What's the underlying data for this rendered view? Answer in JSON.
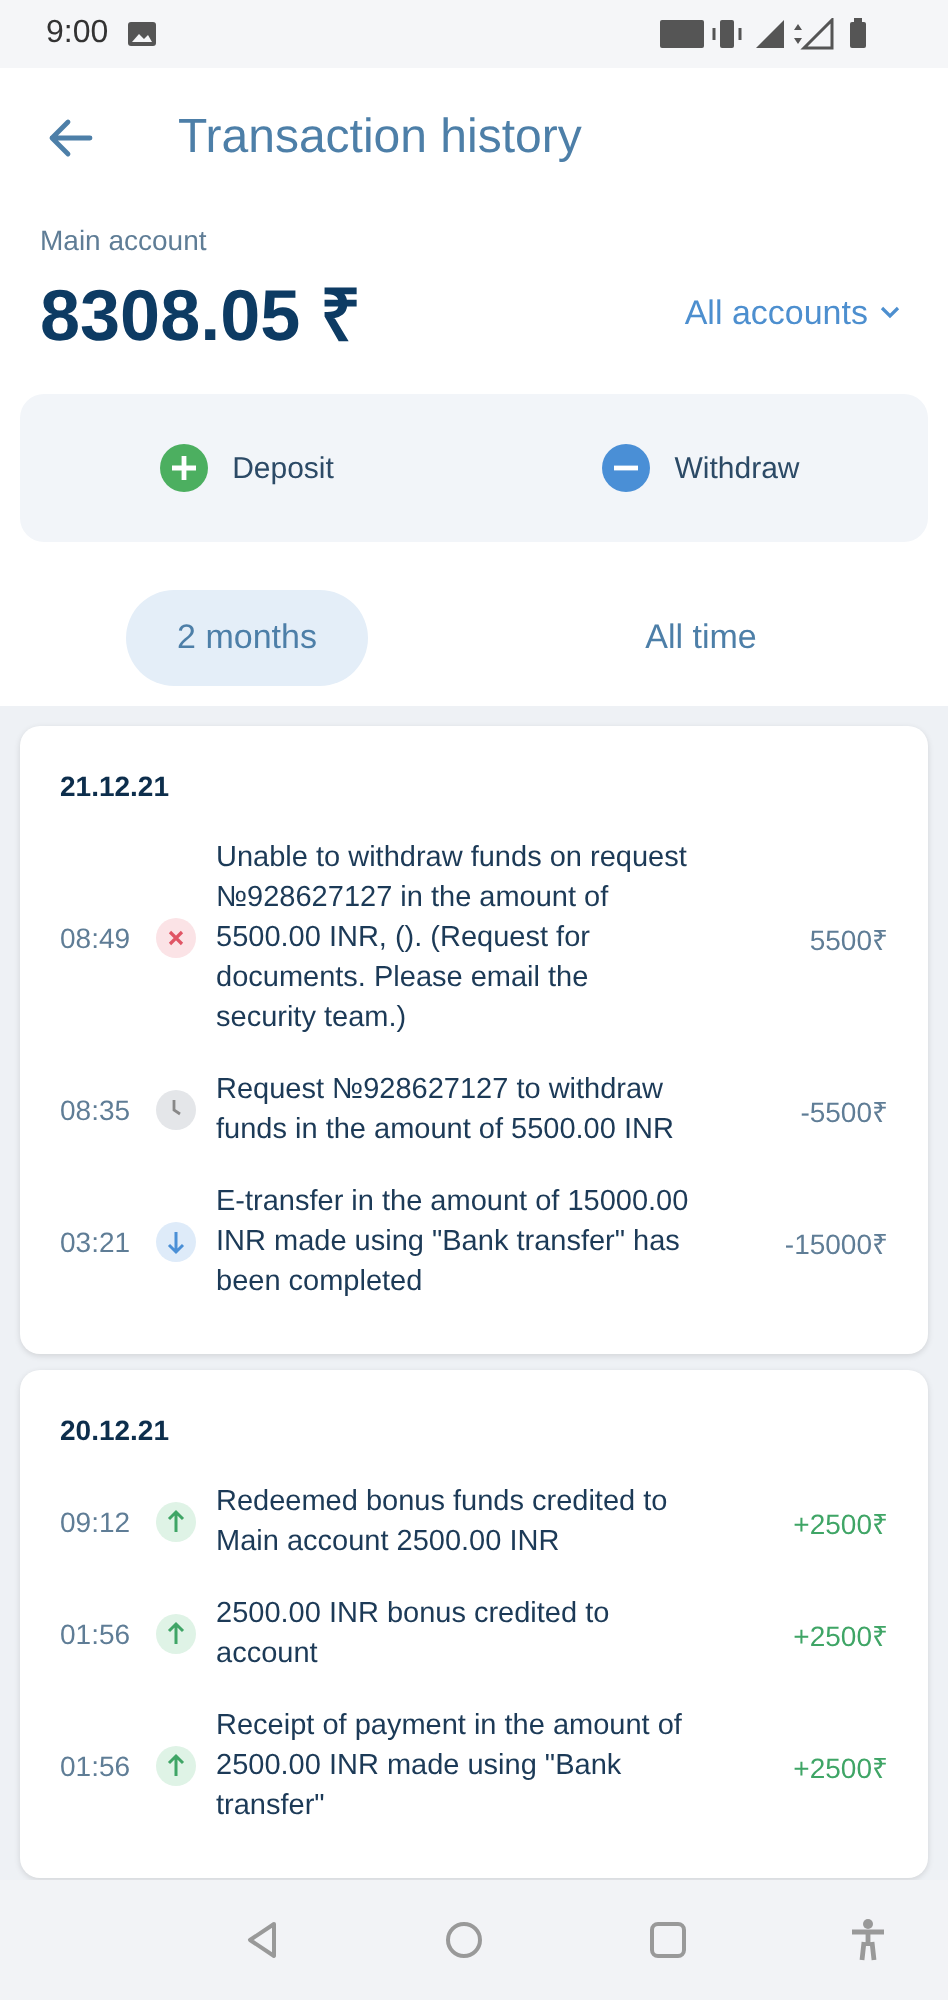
{
  "status_bar": {
    "time": "9:00"
  },
  "header": {
    "title": "Transaction history"
  },
  "account": {
    "label": "Main account",
    "balance": "8308.05 ₹",
    "selector": "All accounts"
  },
  "actions": [
    {
      "kind": "deposit",
      "label": "Deposit"
    },
    {
      "kind": "withdraw",
      "label": "Withdraw"
    }
  ],
  "periods": [
    {
      "label": "2 months",
      "selected": true
    },
    {
      "label": "All time",
      "selected": false
    }
  ],
  "days": [
    {
      "date": "21.12.21",
      "transactions": [
        {
          "time": "08:49",
          "kind": "failed",
          "description": "Unable to withdraw funds on request №928627127 in the amount of 5500.00 INR,  (). (Request for documents. Please email the security team.)",
          "amount": "5500₹"
        },
        {
          "time": "08:35",
          "kind": "pending",
          "description": "Request №928627127 to withdraw funds in the amount of 5500.00 INR",
          "amount": "-5500₹"
        },
        {
          "time": "03:21",
          "kind": "outgoing",
          "description": "E-transfer in the amount of 15000.00 INR made using \"Bank transfer\" has been completed",
          "amount": "-15000₹"
        }
      ]
    },
    {
      "date": "20.12.21",
      "transactions": [
        {
          "time": "09:12",
          "kind": "incoming",
          "description": "Redeemed bonus funds credited to Main account 2500.00 INR",
          "amount": "+2500₹"
        },
        {
          "time": "01:56",
          "kind": "incoming",
          "description": "2500.00 INR bonus credited to account",
          "amount": "+2500₹"
        },
        {
          "time": "01:56",
          "kind": "incoming",
          "description": "Receipt of payment in the amount of 2500.00 INR made using \"Bank transfer\"",
          "amount": "+2500₹"
        }
      ]
    }
  ]
}
